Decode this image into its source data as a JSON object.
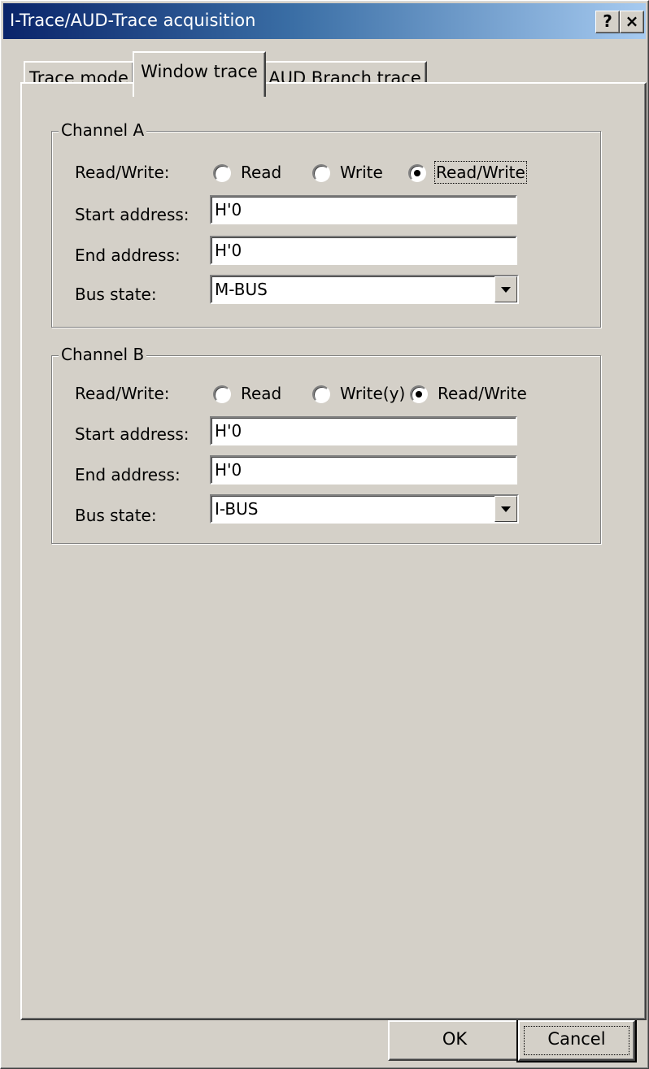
{
  "window": {
    "title": "I-Trace/AUD-Trace acquisition",
    "help_button": "?",
    "close_button": "×"
  },
  "tabs": [
    {
      "label": "Trace mode",
      "selected": false
    },
    {
      "label": "Window trace",
      "selected": true
    },
    {
      "label": "AUD Branch trace",
      "selected": false
    }
  ],
  "channel_a": {
    "legend": "Channel A",
    "rw_label": "Read/Write:",
    "radios": [
      {
        "label": "Read",
        "checked": false
      },
      {
        "label": "Write",
        "checked": false
      },
      {
        "label": "Read/Write",
        "checked": true
      }
    ],
    "start_label": "Start address:",
    "start_value": "H'0",
    "end_label": "End address:",
    "end_value": "H'0",
    "bus_label": "Bus state:",
    "bus_value": "M-BUS"
  },
  "channel_b": {
    "legend": "Channel B",
    "rw_label": "Read/Write:",
    "radios": [
      {
        "label": "Read",
        "checked": false
      },
      {
        "label": "Write(y)",
        "checked": false
      },
      {
        "label": "Read/Write",
        "checked": true
      }
    ],
    "start_label": "Start address:",
    "start_value": "H'0",
    "end_label": "End address:",
    "end_value": "H'0",
    "bus_label": "Bus state:",
    "bus_value": "I-BUS"
  },
  "buttons": {
    "ok": "OK",
    "cancel": "Cancel"
  },
  "colors": {
    "face": "#d4d0c8",
    "title_start": "#0a246a",
    "title_end": "#a6caf0"
  }
}
